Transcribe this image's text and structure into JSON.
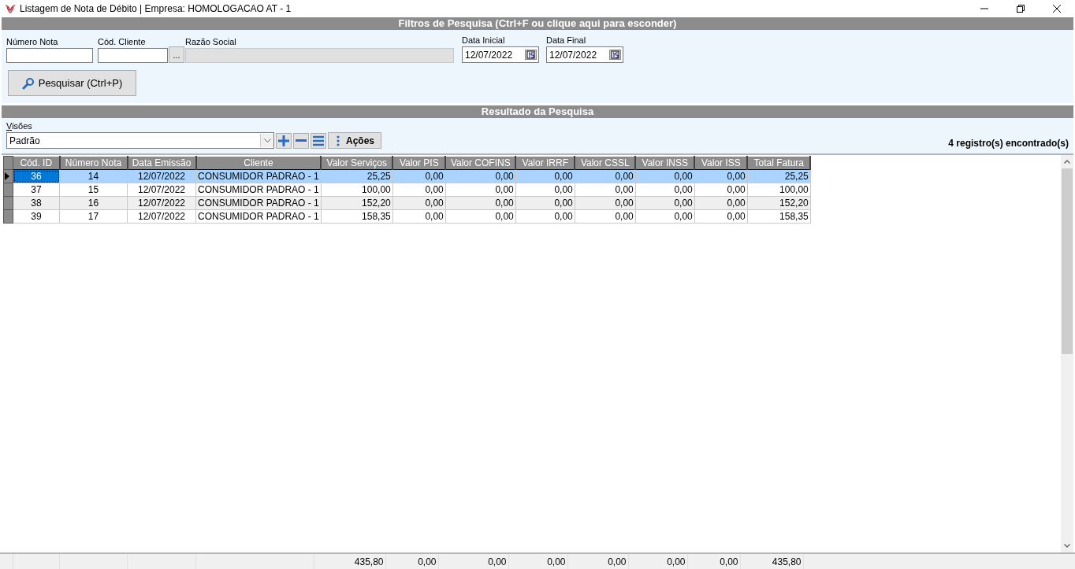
{
  "window": {
    "title": "Listagem de Nota de Débito | Empresa: HOMOLOGACAO AT - 1"
  },
  "filters": {
    "header": "Filtros de Pesquisa (Ctrl+F ou clique aqui para esconder)",
    "numero_nota": {
      "label": "Número Nota"
    },
    "cod_cliente": {
      "label": "Cód. Cliente",
      "lookup_button": "..."
    },
    "razao_social": {
      "label": "Razão Social",
      "disabled": true
    },
    "data_inicial": {
      "label": "Data Inicial",
      "value": "12/07/2022"
    },
    "data_final": {
      "label": "Data Final",
      "value": "12/07/2022"
    },
    "search_button": "Pesquisar (Ctrl+P)"
  },
  "results": {
    "header": "Resultado da Pesquisa",
    "views_label": "Visões",
    "view_value": "Padrão",
    "actions_button": "Ações",
    "count": "4 registro(s) encontrado(s)",
    "table": {
      "columns": [
        "Cód. ID",
        "Número Nota",
        "Data Emissão",
        "Cliente",
        "Valor Serviços",
        "Valor PIS",
        "Valor COFINS",
        "Valor IRRF",
        "Valor CSSL",
        "Valor INSS",
        "Valor ISS",
        "Total Fatura"
      ],
      "rows": [
        {
          "selected": true,
          "cells": [
            "36",
            "14",
            "12/07/2022",
            "CONSUMIDOR PADRAO - 1",
            "25,25",
            "0,00",
            "0,00",
            "0,00",
            "0,00",
            "0,00",
            "0,00",
            "25,25"
          ]
        },
        {
          "selected": false,
          "cells": [
            "37",
            "15",
            "12/07/2022",
            "CONSUMIDOR PADRAO - 1",
            "100,00",
            "0,00",
            "0,00",
            "0,00",
            "0,00",
            "0,00",
            "0,00",
            "100,00"
          ]
        },
        {
          "selected": false,
          "cells": [
            "38",
            "16",
            "12/07/2022",
            "CONSUMIDOR PADRAO - 1",
            "152,20",
            "0,00",
            "0,00",
            "0,00",
            "0,00",
            "0,00",
            "0,00",
            "152,20"
          ]
        },
        {
          "selected": false,
          "cells": [
            "39",
            "17",
            "12/07/2022",
            "CONSUMIDOR PADRAO - 1",
            "158,35",
            "0,00",
            "0,00",
            "0,00",
            "0,00",
            "0,00",
            "0,00",
            "158,35"
          ]
        }
      ],
      "totals": [
        "435,80",
        "0,00",
        "0,00",
        "0,00",
        "0,00",
        "0,00",
        "0,00",
        "435,80"
      ]
    }
  }
}
